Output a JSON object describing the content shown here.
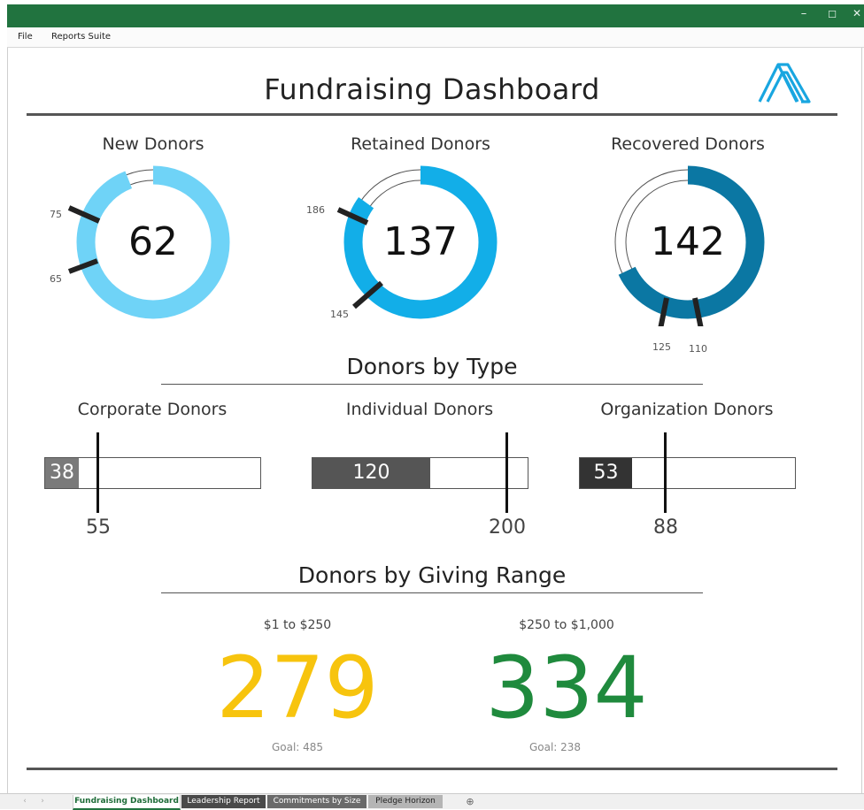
{
  "window": {
    "minimize_glyph": "–",
    "maximize_glyph": "☐",
    "close_glyph": "✕"
  },
  "menu": {
    "file": "File",
    "reports_suite": "Reports Suite"
  },
  "header": {
    "title": "Fundraising Dashboard",
    "logo_icon": "chevron-logo-icon"
  },
  "donor_gauges": [
    {
      "label": "New Donors",
      "value": "62",
      "markers": [
        "75",
        "65"
      ],
      "progress_fraction": 0.94,
      "color": "#6fd3f7"
    },
    {
      "label": "Retained Donors",
      "value": "137",
      "markers": [
        "186",
        "145"
      ],
      "progress_fraction": 0.85,
      "color": "#12aee8"
    },
    {
      "label": "Recovered Donors",
      "value": "142",
      "markers": [
        "125",
        "110"
      ],
      "progress_fraction": 0.68,
      "color": "#0b77a3"
    }
  ],
  "donors_by_type": {
    "title": "Donors by Type",
    "bars": [
      {
        "label": "Corporate Donors",
        "value": "38",
        "target": "55",
        "fill_fraction": 0.155,
        "target_fraction": 0.245,
        "color": "#7a7a7a"
      },
      {
        "label": "Individual Donors",
        "value": "120",
        "target": "200",
        "fill_fraction": 0.545,
        "target_fraction": 0.9,
        "color": "#555555"
      },
      {
        "label": "Organization Donors",
        "value": "53",
        "target": "88",
        "fill_fraction": 0.24,
        "target_fraction": 0.4,
        "color": "#333333"
      }
    ]
  },
  "giving_range": {
    "title": "Donors by Giving Range",
    "items": [
      {
        "label": "$1 to $250",
        "value": "279",
        "goal": "Goal: 485",
        "color": "#f7c40e"
      },
      {
        "label": "$250 to $1,000",
        "value": "334",
        "goal": "Goal: 238",
        "color": "#1f8a3d"
      }
    ]
  },
  "tabs": {
    "fundraising": "Fundraising Dashboard",
    "leadership": "Leadership Report",
    "commitments": "Commitments by Size",
    "pledge": "Pledge Horizon",
    "add": "⊕",
    "nav_prev": "‹",
    "nav_next": "›"
  }
}
